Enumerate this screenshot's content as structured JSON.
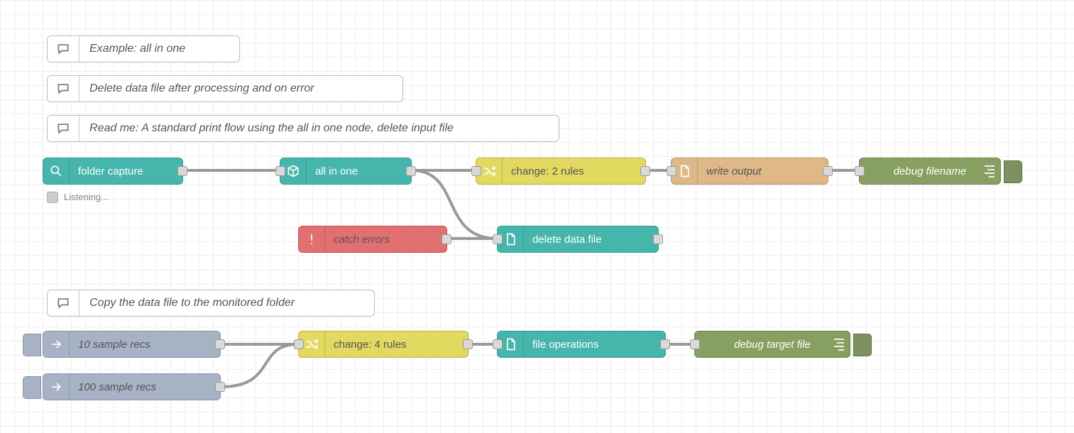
{
  "comments": {
    "c1": "Example: all in one",
    "c2": "Delete data file after processing and on error",
    "c3": "Read me: A standard print flow using the all in one node, delete input file",
    "c4": "Copy the data file to the monitored folder"
  },
  "nodes": {
    "folder_capture": "folder capture",
    "all_in_one": "all in one",
    "change2": "change: 2 rules",
    "write_output": "write output",
    "debug_filename": "debug filename",
    "catch_errors": "catch errors",
    "delete_data_file": "delete data file",
    "sample10": "10 sample recs",
    "sample100": "100 sample recs",
    "change4": "change: 4 rules",
    "file_ops": "file operations",
    "debug_target": "debug target file"
  },
  "status": {
    "folder_capture": "Listening..."
  }
}
